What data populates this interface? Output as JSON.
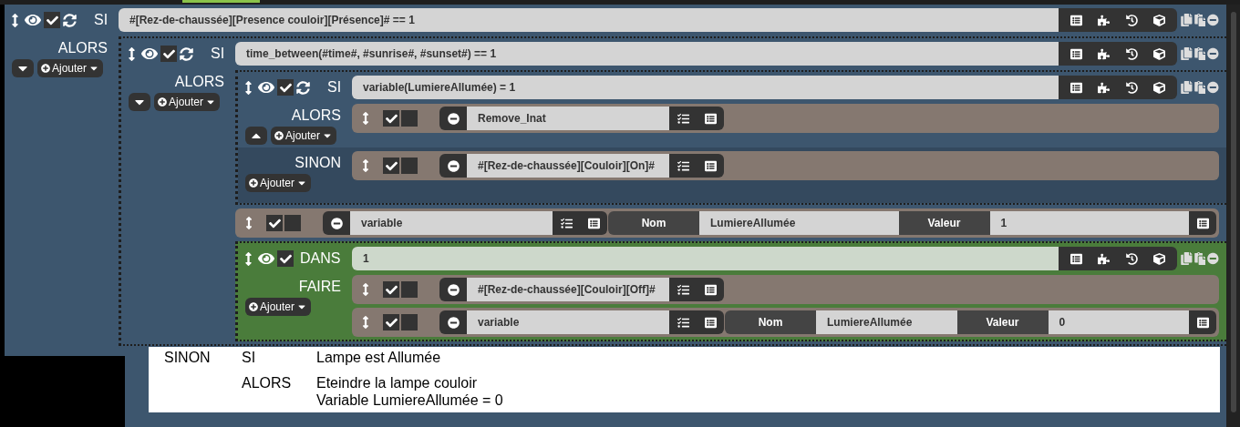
{
  "scenario": {
    "kind": "si",
    "keyword": "SI",
    "visible": true,
    "enabled": true,
    "expression": "#[Rez-de-chaussée][Presence couloir][Présence]# == 1",
    "branches": [
      {
        "kind": "then",
        "label": "ALORS",
        "expanded": false,
        "add_button": "Ajouter",
        "items": [
          {
            "kind": "si",
            "keyword": "SI",
            "visible": true,
            "enabled": true,
            "expression": "time_between(#time#, #sunrise#, #sunset#) == 1",
            "branches": [
              {
                "kind": "then",
                "label": "ALORS",
                "expanded": false,
                "add_button": "Ajouter",
                "items": [
                  {
                    "kind": "si",
                    "keyword": "SI",
                    "visible": true,
                    "enabled": true,
                    "expression": "variable(LumiereAllumée) = 1",
                    "branches": [
                      {
                        "kind": "then",
                        "label": "ALORS",
                        "expanded": true,
                        "add_button": "Ajouter",
                        "items": [
                          {
                            "kind": "action",
                            "enabled": true,
                            "option": false,
                            "command": "Remove_Inat"
                          }
                        ]
                      },
                      {
                        "kind": "else",
                        "label": "SINON",
                        "add_button": "Ajouter",
                        "items": [
                          {
                            "kind": "action",
                            "enabled": true,
                            "option": false,
                            "command": "#[Rez-de-chaussée][Couloir][On]#"
                          }
                        ]
                      }
                    ]
                  },
                  {
                    "kind": "variable",
                    "enabled": true,
                    "option": false,
                    "command": "variable",
                    "name_label": "Nom",
                    "name": "LumiereAllumée",
                    "value_label": "Valeur",
                    "value": "1"
                  },
                  {
                    "kind": "dans",
                    "keyword": "DANS",
                    "visible": true,
                    "enabled": true,
                    "expression": "1",
                    "branches": [
                      {
                        "kind": "then",
                        "label": "FAIRE",
                        "add_button": "Ajouter",
                        "items": [
                          {
                            "kind": "action",
                            "enabled": true,
                            "option": false,
                            "command": "#[Rez-de-chaussée][Couloir][Off]#"
                          },
                          {
                            "kind": "variable",
                            "enabled": true,
                            "option": false,
                            "command": "variable",
                            "name_label": "Nom",
                            "name": "LumiereAllumée",
                            "value_label": "Valeur",
                            "value": "0"
                          }
                        ]
                      }
                    ]
                  }
                ]
              }
            ]
          }
        ]
      }
    ]
  },
  "note": {
    "rows": [
      {
        "section": "SINON",
        "keyword": "SI",
        "lines": [
          "Lampe est Allumée"
        ]
      },
      {
        "keyword": "ALORS",
        "lines": [
          "Eteindre la lampe couloir",
          "Variable LumiereAllumée = 0"
        ]
      }
    ]
  }
}
